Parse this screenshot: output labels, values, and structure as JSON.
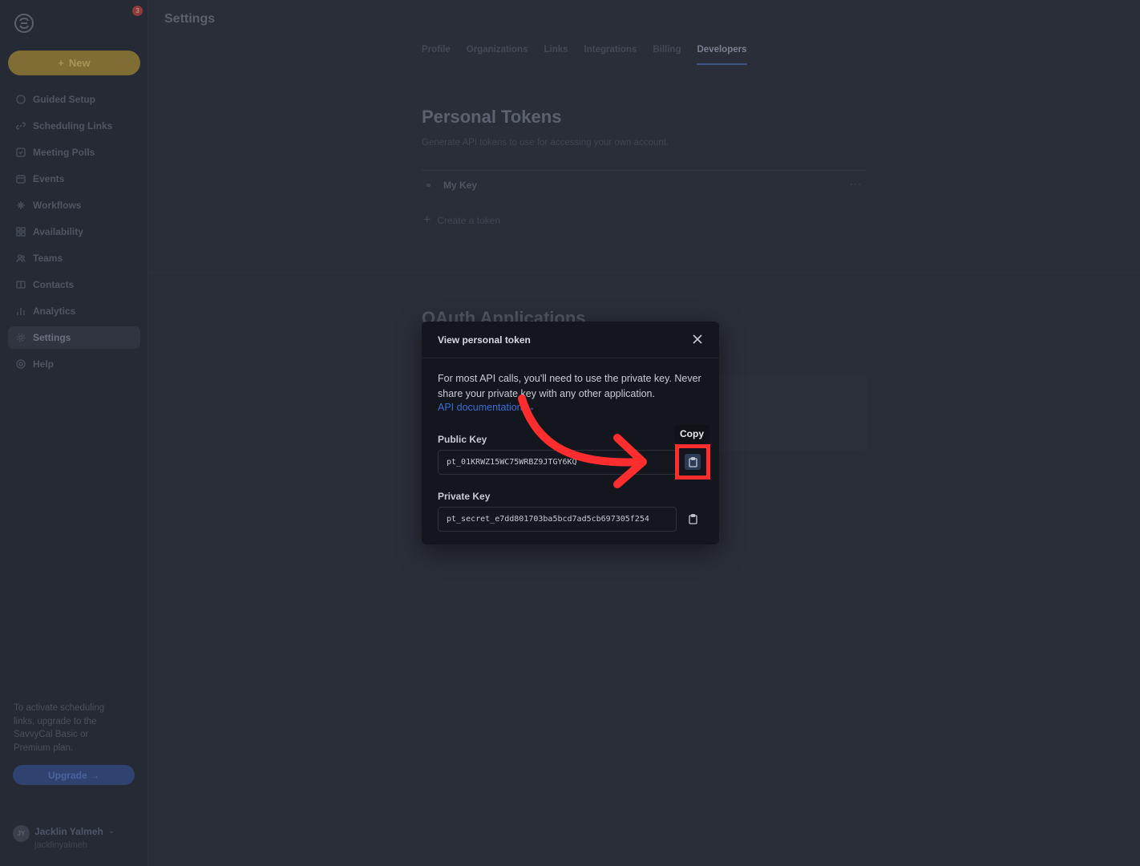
{
  "app": {
    "notification_count": "3",
    "new_button_label": "New"
  },
  "sidebar": {
    "items": [
      {
        "label": "Guided Setup",
        "icon": "circle-icon"
      },
      {
        "label": "Scheduling Links",
        "icon": "link-icon"
      },
      {
        "label": "Meeting Polls",
        "icon": "poll-icon"
      },
      {
        "label": "Events",
        "icon": "calendar-icon"
      },
      {
        "label": "Workflows",
        "icon": "sparkle-icon"
      },
      {
        "label": "Availability",
        "icon": "grid-icon"
      },
      {
        "label": "Teams",
        "icon": "users-icon"
      },
      {
        "label": "Contacts",
        "icon": "contacts-icon"
      },
      {
        "label": "Analytics",
        "icon": "bar-chart-icon"
      },
      {
        "label": "Settings",
        "icon": "gear-icon",
        "active": true
      },
      {
        "label": "Help",
        "icon": "help-icon"
      }
    ],
    "upgrade_note": "To activate scheduling links, upgrade to the SavvyCal Basic or Premium plan.",
    "upgrade_button": "Upgrade →",
    "user": {
      "initials": "JY",
      "name": "Jacklin Yalmeh",
      "handle": "jacklinyalmeh"
    }
  },
  "header": {
    "title": "Settings"
  },
  "tabs": [
    {
      "label": "Profile"
    },
    {
      "label": "Organizations"
    },
    {
      "label": "Links"
    },
    {
      "label": "Integrations"
    },
    {
      "label": "Billing"
    },
    {
      "label": "Developers",
      "active": true
    }
  ],
  "personal_tokens": {
    "title": "Personal Tokens",
    "subtitle": "Generate API tokens to use for accessing your own account.",
    "tokens": [
      {
        "name": "My Key"
      }
    ],
    "create_label": "Create a token"
  },
  "oauth": {
    "title": "OAuth Applications"
  },
  "modal": {
    "title": "View personal token",
    "description": "For most API calls, you'll need to use the private key. Never share your private key with any other application.",
    "link_label": "API documentation →",
    "public_key_label": "Public Key",
    "public_key_value": "pt_01KRWZ15WC75WRBZ9JTGY6KQ",
    "private_key_label": "Private Key",
    "private_key_value": "pt_secret_e7dd801703ba5bcd7ad5cb697305f254",
    "tooltip": "Copy"
  },
  "colors": {
    "accent": "#3b6fd6",
    "highlight": "#ff2d2d",
    "background": "#2a2e39",
    "modal_bg": "#13161d"
  }
}
